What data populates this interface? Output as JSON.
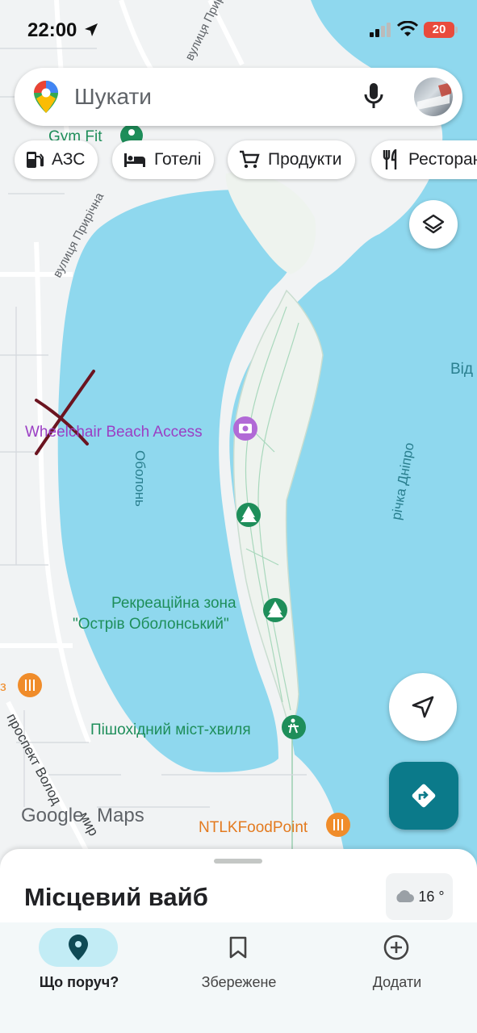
{
  "status_bar": {
    "time": "22:00",
    "battery": "20"
  },
  "search": {
    "placeholder": "Шукати"
  },
  "chips": [
    {
      "label": "АЗС",
      "icon": "gas-station-icon"
    },
    {
      "label": "Готелі",
      "icon": "hotel-bed-icon"
    },
    {
      "label": "Продукти",
      "icon": "shopping-cart-icon"
    },
    {
      "label": "Ресторани",
      "icon": "restaurant-icon"
    }
  ],
  "map_labels": {
    "gym": "Gym Fit",
    "street_top": "вулиця Прирі",
    "street_left": "вулиця Прирічна",
    "wheelchair": "Wheelchair Beach Access",
    "obolon": "Оболонь",
    "vid": "Від",
    "river": "річка Дніпро",
    "recreation_line1": "Рекреаційна зона",
    "recreation_line2": "\"Острів Оболонський\"",
    "bridge": "Пішохідний міст-хвиля",
    "food_point": "NTLKFoodPoint",
    "prospekt": "проспект Волод",
    "mir": "мир",
    "edge_z": "з",
    "logo_google": "Google",
    "logo_maps": "Maps"
  },
  "sheet": {
    "title": "Місцевий вайб",
    "weather": "16 °"
  },
  "bottom_nav": [
    {
      "label": "Що поруч?",
      "icon": "location-pin-icon",
      "active": true
    },
    {
      "label": "Збережене",
      "icon": "bookmark-icon",
      "active": false
    },
    {
      "label": "Додати",
      "icon": "add-circle-icon",
      "active": false
    }
  ],
  "colors": {
    "water": "#8fd8ee",
    "land": "#f1f3f4",
    "park_label": "#1e8e5a",
    "poi_purple": "#9b3fc4",
    "restaurant_orange": "#f08c2a",
    "directions_teal": "#0b7a8a",
    "annotation_mark": "#6b1420"
  }
}
